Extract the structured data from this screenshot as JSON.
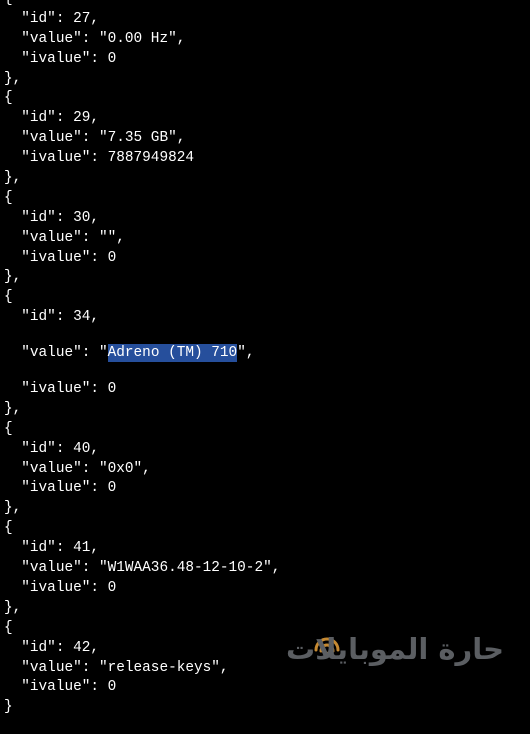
{
  "json_view": {
    "lines_before_selection": [
      "{",
      "  \"id\": 27,",
      "  \"value\": \"0.00 Hz\",",
      "  \"ivalue\": 0",
      "},",
      "{",
      "  \"id\": 29,",
      "  \"value\": \"7.35 GB\",",
      "  \"ivalue\": 7887949824",
      "},",
      "{",
      "  \"id\": 30,",
      "  \"value\": \"\",",
      "  \"ivalue\": 0",
      "},",
      "{",
      "  \"id\": 34,"
    ],
    "selected_line": {
      "prefix": "  \"value\": \"",
      "selected_text": "Adreno (TM) 710",
      "suffix": "\","
    },
    "lines_after_selection": [
      "  \"ivalue\": 0",
      "},",
      "{",
      "  \"id\": 40,",
      "  \"value\": \"0x0\",",
      "  \"ivalue\": 0",
      "},",
      "{",
      "  \"id\": 41,",
      "  \"value\": \"W1WAA36.48-12-10-2\",",
      "  \"ivalue\": 0",
      "},",
      "{",
      "  \"id\": 42,",
      "  \"value\": \"release-keys\",",
      "  \"ivalue\": 0",
      "}"
    ]
  },
  "watermark": {
    "text": "حارة الموبايلات",
    "color": "#6b6f74",
    "accent_color": "#e8a13a",
    "icon": "wifi-arc-icon"
  },
  "colors": {
    "background": "#000000",
    "text": "#ffffff",
    "selection": "#264f9c"
  }
}
